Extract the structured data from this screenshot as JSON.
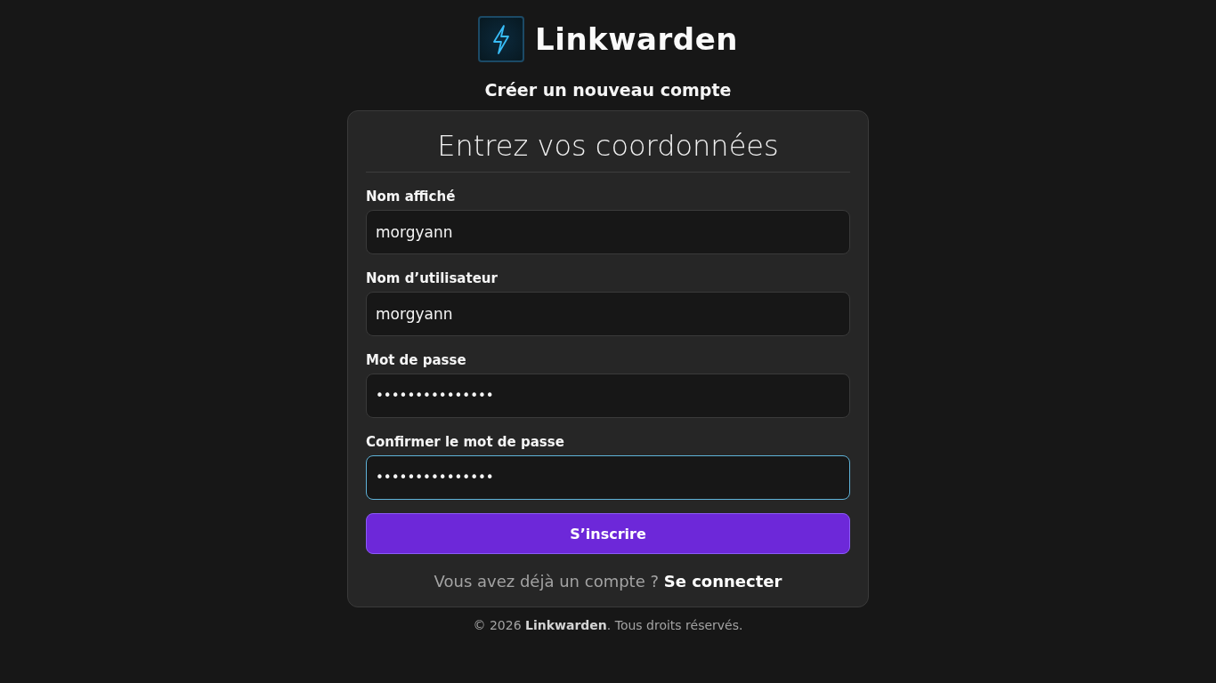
{
  "brand": {
    "name": "Linkwarden"
  },
  "subtitle": "Créer un nouveau compte",
  "card": {
    "heading": "Entrez vos coordonnées",
    "fields": [
      {
        "label": "Nom affiché",
        "value": "morgyann",
        "kind": "text",
        "focused": false
      },
      {
        "label": "Nom d’utilisateur",
        "value": "morgyann",
        "kind": "text",
        "focused": false
      },
      {
        "label": "Mot de passe",
        "value": "•••••••••••••••",
        "kind": "password",
        "focused": false
      },
      {
        "label": "Confirmer le mot de passe",
        "value": "•••••••••••••••",
        "kind": "password",
        "focused": true
      }
    ],
    "submit": "S’inscrire",
    "signin_prompt": "Vous avez déjà un compte ?",
    "signin_link": "Se connecter"
  },
  "footer": "© 2026 **Linkwarden**. Tous droits réservés."
}
